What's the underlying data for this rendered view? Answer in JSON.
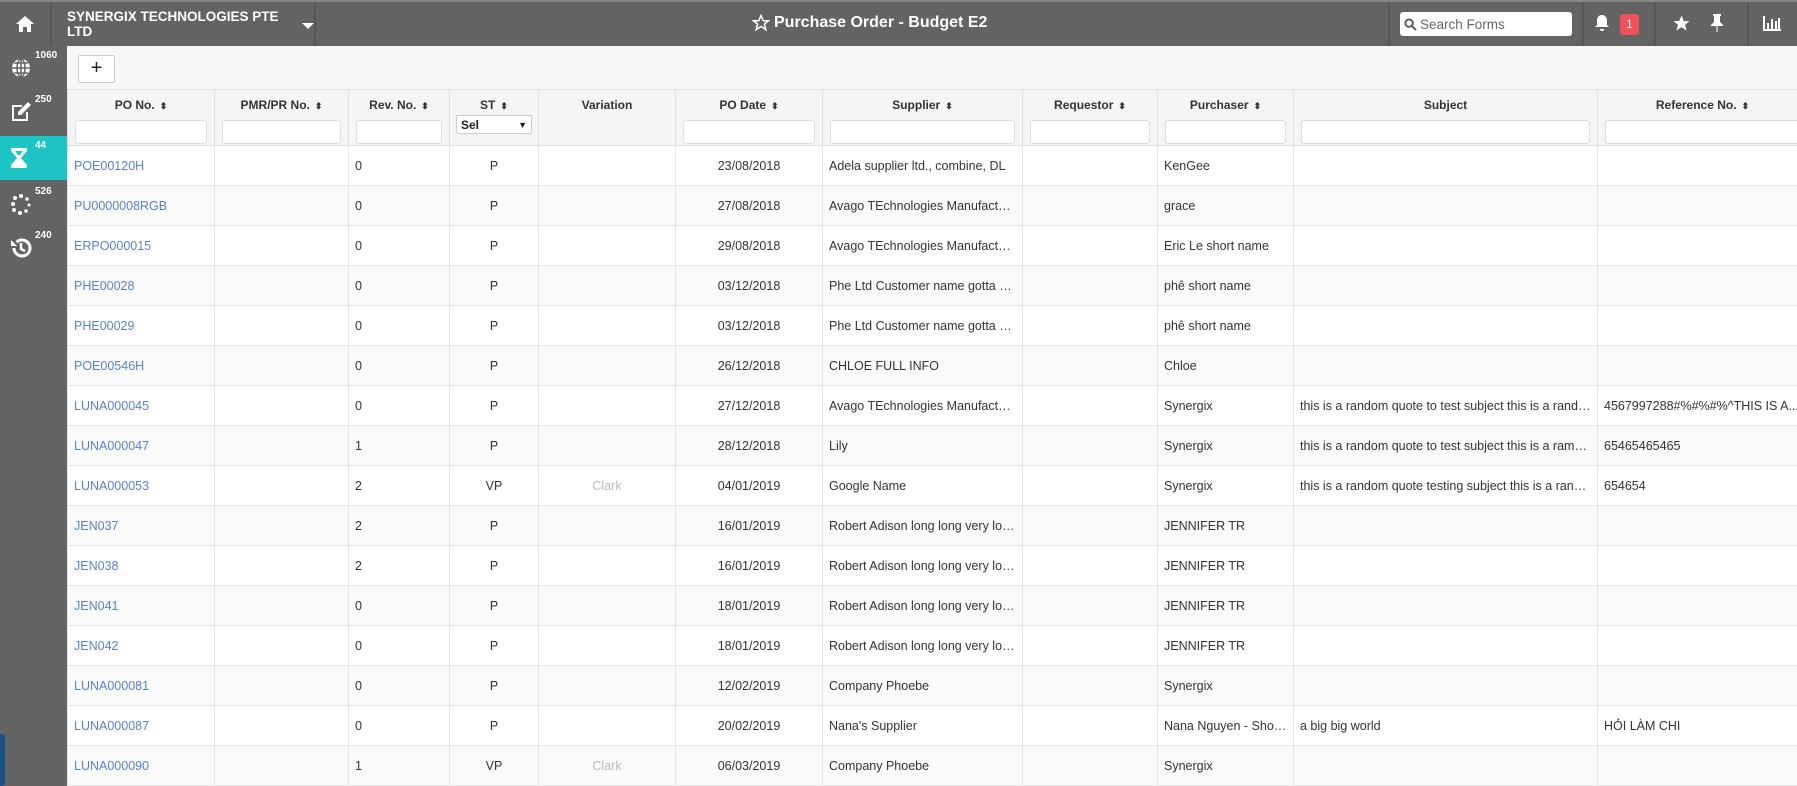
{
  "header": {
    "company": "SYNERGIX TECHNOLOGIES PTE LTD",
    "title": "Purchase Order - Budget E2",
    "search_placeholder": "Search Forms",
    "notification_count": "1"
  },
  "sidebar": {
    "items": [
      {
        "icon": "globe-icon",
        "count": "1060"
      },
      {
        "icon": "edit-icon",
        "count": "250"
      },
      {
        "icon": "hourglass-icon",
        "count": "44",
        "active": true
      },
      {
        "icon": "spinner-icon",
        "count": "526"
      },
      {
        "icon": "history-icon",
        "count": "240"
      }
    ]
  },
  "toolbar": {
    "add_label": "+"
  },
  "table": {
    "columns": [
      "PO No.",
      "PMR/PR No.",
      "Rev. No.",
      "ST",
      "Variation",
      "PO Date",
      "Supplier",
      "Requestor",
      "Purchaser",
      "Subject",
      "Reference No."
    ],
    "st_filter": "Sel",
    "rows": [
      [
        "POE00120H",
        "",
        "0",
        "P",
        "",
        "23/08/2018",
        "Adela supplier ltd., combine, DL",
        "",
        "KenGee",
        "",
        ""
      ],
      [
        "PU0000008RGB",
        "",
        "0",
        "P",
        "",
        "27/08/2018",
        "Avago TEchnologies Manufactui...",
        "",
        "grace",
        "",
        ""
      ],
      [
        "ERPO000015",
        "",
        "0",
        "P",
        "",
        "29/08/2018",
        "Avago TEchnologies Manufactui...",
        "",
        "Eric Le short name",
        "",
        ""
      ],
      [
        "PHE00028",
        "",
        "0",
        "P",
        "",
        "03/12/2018",
        "Phe Ltd Customer name gotta be...",
        "",
        "phê short name",
        "",
        ""
      ],
      [
        "PHE00029",
        "",
        "0",
        "P",
        "",
        "03/12/2018",
        "Phe Ltd Customer name gotta be...",
        "",
        "phê short name",
        "",
        ""
      ],
      [
        "POE00546H",
        "",
        "0",
        "P",
        "",
        "26/12/2018",
        "CHLOE FULL INFO",
        "",
        "Chloe",
        "",
        ""
      ],
      [
        "LUNA000045",
        "",
        "0",
        "P",
        "",
        "27/12/2018",
        "Avago TEchnologies Manufactui...",
        "",
        "Synergix",
        "this is a random quote to test subject this is a rando...",
        "4567997288#%#%#%^THIS IS A..."
      ],
      [
        "LUNA000047",
        "",
        "1",
        "P",
        "",
        "28/12/2018",
        "Lily",
        "",
        "Synergix",
        "this is a random quote to test subject this is a ramdo...",
        "65465465465"
      ],
      [
        "LUNA000053",
        "",
        "2",
        "VP",
        "Clark",
        "04/01/2019",
        "Google Name",
        "",
        "Synergix",
        "this is a random quote testing subject this is a rando...",
        "654654"
      ],
      [
        "JEN037",
        "",
        "2",
        "P",
        "",
        "16/01/2019",
        "Robert Adison long long very lon...",
        "",
        "JENNIFER TR",
        "",
        ""
      ],
      [
        "JEN038",
        "",
        "2",
        "P",
        "",
        "16/01/2019",
        "Robert Adison long long very lon...",
        "",
        "JENNIFER TR",
        "",
        ""
      ],
      [
        "JEN041",
        "",
        "0",
        "P",
        "",
        "18/01/2019",
        "Robert Adison long long very lon...",
        "",
        "JENNIFER TR",
        "",
        ""
      ],
      [
        "JEN042",
        "",
        "0",
        "P",
        "",
        "18/01/2019",
        "Robert Adison long long very lon...",
        "",
        "JENNIFER TR",
        "",
        ""
      ],
      [
        "LUNA000081",
        "",
        "0",
        "P",
        "",
        "12/02/2019",
        "Company Phoebe",
        "",
        "Synergix",
        "",
        ""
      ],
      [
        "LUNA000087",
        "",
        "0",
        "P",
        "",
        "20/02/2019",
        "Nana's Supplier",
        "",
        "Nana Nguyen - Shor...",
        "a big big world",
        "HỎI LÀM CHI"
      ],
      [
        "LUNA000090",
        "",
        "1",
        "VP",
        "Clark",
        "06/03/2019",
        "Company Phoebe",
        "",
        "Synergix",
        "",
        ""
      ]
    ]
  }
}
